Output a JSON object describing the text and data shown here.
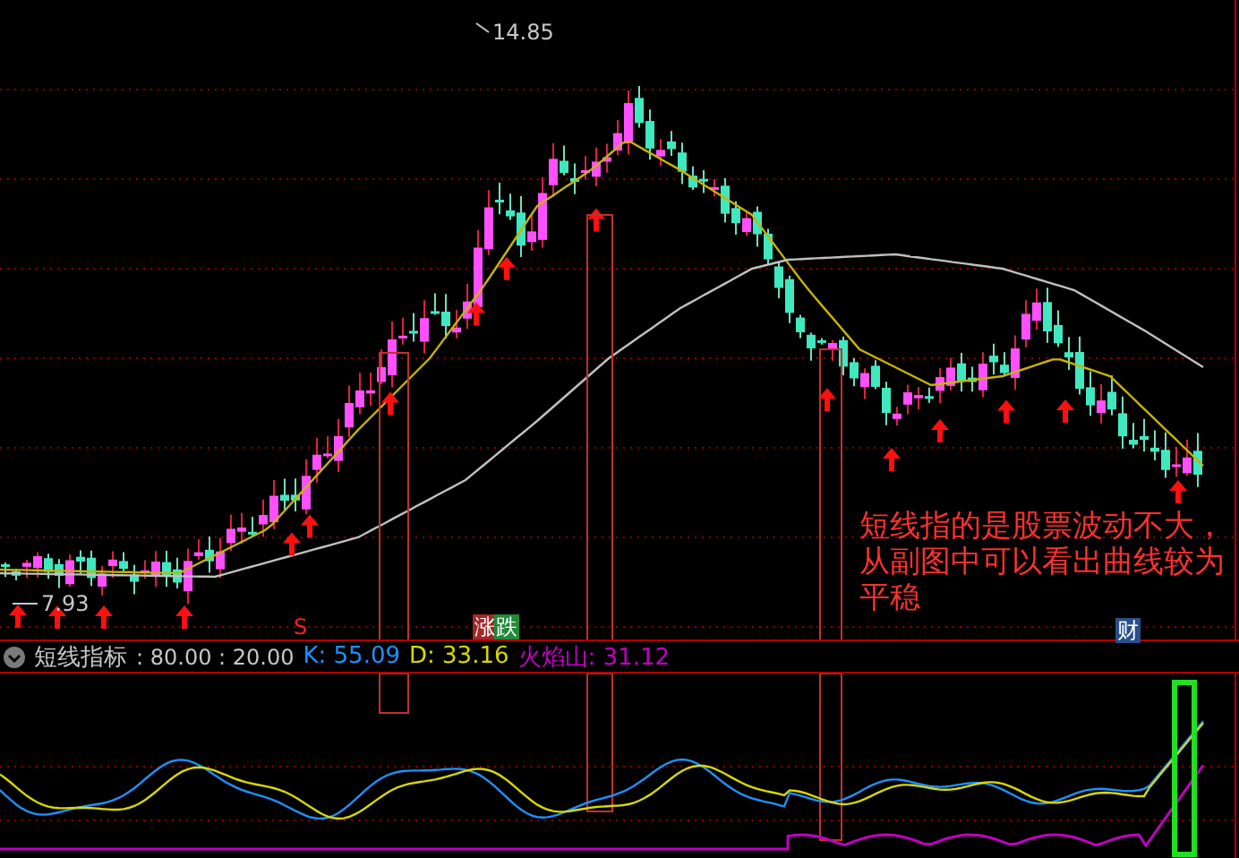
{
  "main_chart": {
    "high_label": "14.85",
    "low_label": "7.93",
    "event_badges": [
      {
        "text": "S",
        "kind": "plain"
      },
      {
        "text": "涨",
        "kind": "up"
      },
      {
        "text": "跌",
        "kind": "down"
      },
      {
        "text": "财",
        "kind": "finance"
      }
    ],
    "annotation": "短线指的是股票波动不大，从副图中可以看出曲线较为平稳"
  },
  "indicator": {
    "name": "短线指标",
    "params": ": 80.00 : 20.00",
    "values": [
      {
        "label": "K: 55.09",
        "color": "#1e90ff"
      },
      {
        "label": "D: 33.16",
        "color": "#d8d800"
      },
      {
        "label": "火焰山: 31.12",
        "color": "#c000c0"
      }
    ]
  }
}
